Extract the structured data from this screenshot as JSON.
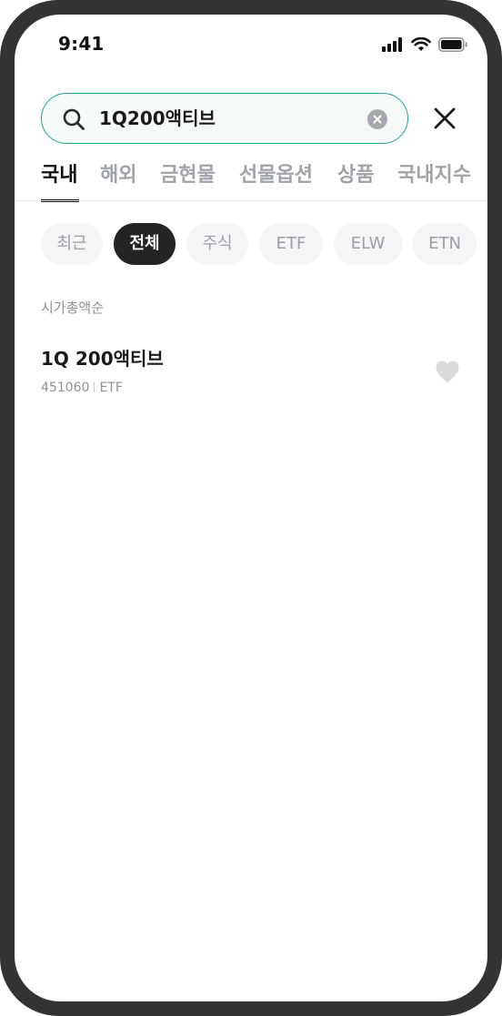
{
  "status_bar": {
    "time": "9:41",
    "icons": [
      "signal-icon",
      "wifi-icon",
      "battery-icon"
    ]
  },
  "search": {
    "value": "1Q200액티브",
    "icons": {
      "search": "search-icon",
      "clear": "clear-icon",
      "close": "close-icon"
    }
  },
  "tabs": [
    {
      "label": "국내",
      "active": true
    },
    {
      "label": "해외",
      "active": false
    },
    {
      "label": "금현물",
      "active": false
    },
    {
      "label": "선물옵션",
      "active": false
    },
    {
      "label": "상품",
      "active": false
    },
    {
      "label": "국내지수",
      "active": false
    }
  ],
  "chips": [
    {
      "label": "최근",
      "active": false
    },
    {
      "label": "전체",
      "active": true
    },
    {
      "label": "주식",
      "active": false
    },
    {
      "label": "ETF",
      "active": false
    },
    {
      "label": "ELW",
      "active": false
    },
    {
      "label": "ETN",
      "active": false
    }
  ],
  "sort_label": "시가총액순",
  "results": [
    {
      "name": "1Q 200액티브",
      "code": "451060",
      "type": "ETF",
      "favorite_icon": "heart-icon"
    }
  ],
  "colors": {
    "accent": "#22a78f",
    "search_bg": "#f5f9f8",
    "text_primary": "#111111",
    "text_secondary": "#8e9196",
    "chip_bg": "#f4f5f6",
    "chip_active_bg": "#222426",
    "heart": "#d9dadc"
  }
}
